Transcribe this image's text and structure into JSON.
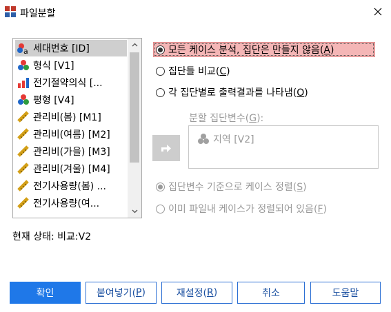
{
  "window": {
    "title": "파일분할"
  },
  "variables": [
    {
      "label": "세대번호 [ID]",
      "icon": "nominal-a-icon",
      "selected": true
    },
    {
      "label": "형식 [V1]",
      "icon": "nominal-icon"
    },
    {
      "label": "전기절약의식 [...",
      "icon": "ordinal-icon"
    },
    {
      "label": "평형 [V4]",
      "icon": "nominal-icon"
    },
    {
      "label": "관리비(봄) [M1]",
      "icon": "scale-icon"
    },
    {
      "label": "관리비(여름) [M2]",
      "icon": "scale-icon"
    },
    {
      "label": "관리비(가을) [M3]",
      "icon": "scale-icon"
    },
    {
      "label": "관리비(겨울) [M4]",
      "icon": "scale-icon"
    },
    {
      "label": "전기사용량(봄) ...",
      "icon": "scale-icon"
    },
    {
      "label": "전기사용량(여...",
      "icon": "scale-icon"
    }
  ],
  "options": {
    "all_cases": {
      "text": "모든 케이스 분석, 집단은 만들지 않음(",
      "key": "A",
      "end": ")",
      "selected": true
    },
    "compare": {
      "text": "집단들 비교(",
      "key": "C",
      "end": ")",
      "selected": false
    },
    "organize": {
      "text": "각 집단별로 출력결과를 나타냄(",
      "key": "O",
      "end": ")",
      "selected": false
    }
  },
  "split_by": {
    "label_pre": "분할 집단변수(",
    "label_key": "G",
    "label_post": "):",
    "variable": "지역 [V2]"
  },
  "sort_options": {
    "sort": {
      "text": "집단변수 기준으로 케이스 정렬(",
      "key": "S",
      "end": ")",
      "selected": true
    },
    "already_sorted": {
      "text": "이미 파일내 케이스가 정렬되어 있음(",
      "key": "F",
      "end": ")",
      "selected": false
    }
  },
  "status": "현재 상태: 비교:V2",
  "buttons": {
    "ok": "확인",
    "paste_pre": "붙여넣기(",
    "paste_key": "P",
    "paste_post": ")",
    "reset_pre": "재설정(",
    "reset_key": "R",
    "reset_post": ")",
    "cancel": "취소",
    "help": "도움말"
  },
  "colors": {
    "accent": "#1f78e8",
    "highlight": "#f4b6b6",
    "selection": "#cfcfcf"
  }
}
